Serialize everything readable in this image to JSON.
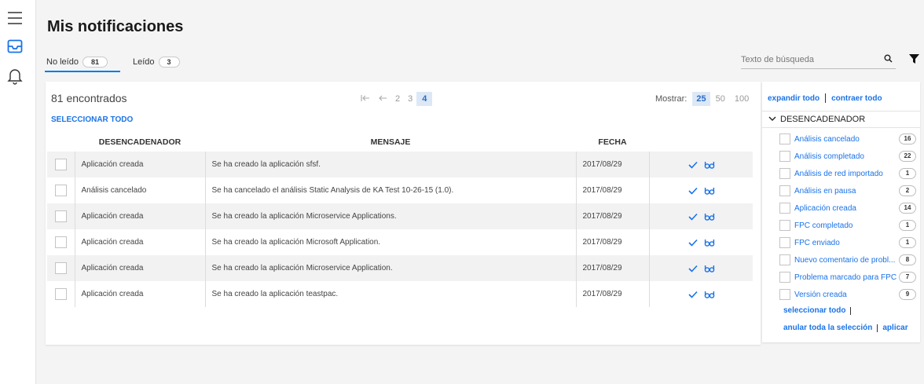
{
  "header": {
    "title": "Mis notificaciones",
    "tabs": [
      {
        "label": "No leído",
        "count": "81"
      },
      {
        "label": "Leído",
        "count": "3"
      }
    ],
    "search_placeholder": "Texto de búsqueda"
  },
  "main": {
    "found_text": "81 encontrados",
    "pagination": {
      "pages": [
        "2",
        "3",
        "4"
      ],
      "current": "4"
    },
    "show_label": "Mostrar:",
    "page_sizes": [
      "25",
      "50",
      "100"
    ],
    "selected_page_size": "25",
    "select_all": "SELECCIONAR TODO",
    "columns": [
      "DESENCADENADOR",
      "MENSAJE",
      "FECHA"
    ],
    "rows": [
      {
        "trigger": "Aplicación creada",
        "message": "Se ha creado la aplicación sfsf.",
        "date": "2017/08/29"
      },
      {
        "trigger": "Análisis cancelado",
        "message": "Se ha cancelado el análisis Static Analysis de KA Test 10-26-15 (1.0).",
        "date": "2017/08/29"
      },
      {
        "trigger": "Aplicación creada",
        "message": "Se ha creado la aplicación Microservice Applications.",
        "date": "2017/08/29"
      },
      {
        "trigger": "Aplicación creada",
        "message": "Se ha creado la aplicación Microsoft Application.",
        "date": "2017/08/29"
      },
      {
        "trigger": "Aplicación creada",
        "message": "Se ha creado la aplicación Microservice Application.",
        "date": "2017/08/29"
      },
      {
        "trigger": "Aplicación creada",
        "message": "Se ha creado la aplicación teastpac.",
        "date": "2017/08/29"
      }
    ]
  },
  "filters": {
    "expand_all": "expandir todo",
    "collapse_all": "contraer todo",
    "group_label": "DESENCADENADOR",
    "items": [
      {
        "label": "Análisis cancelado",
        "count": "16"
      },
      {
        "label": "Análisis completado",
        "count": "22"
      },
      {
        "label": "Análisis de red importado",
        "count": "1"
      },
      {
        "label": "Análisis en pausa",
        "count": "2"
      },
      {
        "label": "Aplicación creada",
        "count": "14"
      },
      {
        "label": "FPC completado",
        "count": "1"
      },
      {
        "label": "FPC enviado",
        "count": "1"
      },
      {
        "label": "Nuevo comentario de probl...",
        "count": "8"
      },
      {
        "label": "Problema marcado para FPC",
        "count": "7"
      },
      {
        "label": "Versión creada",
        "count": "9"
      }
    ],
    "select_all": "seleccionar todo",
    "clear_all": "anular toda la selección",
    "apply": "aplicar"
  },
  "colors": {
    "accent": "#0079ef",
    "link": "#1a73e8"
  },
  "icons": [
    "hamburger-menu-icon",
    "inbox-icon",
    "bell-icon",
    "search-icon",
    "filter-icon",
    "first-page-icon",
    "prev-page-icon",
    "check-icon",
    "mark-unread-icon",
    "chevron-down-icon"
  ]
}
